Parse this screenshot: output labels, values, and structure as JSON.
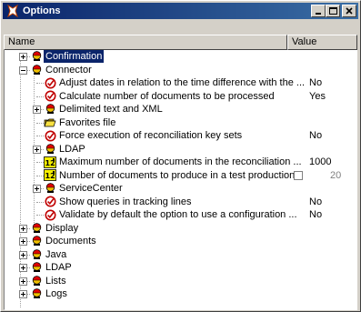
{
  "window": {
    "title": "Options"
  },
  "columns": {
    "name": "Name",
    "value": "Value"
  },
  "tree": [
    {
      "label": "Confirmation",
      "level": 0,
      "expander": "+",
      "icon": "folder-red-icon",
      "selected": true
    },
    {
      "label": "Connector",
      "level": 0,
      "expander": "-",
      "icon": "folder-icon"
    },
    {
      "label": "Adjust dates in relation to the time difference with the ...",
      "level": 1,
      "icon": "check-option-icon",
      "value": "No"
    },
    {
      "label": "Calculate number of documents to be processed",
      "level": 1,
      "icon": "check-option-icon",
      "value": "Yes"
    },
    {
      "label": "Delimited text and XML",
      "level": 1,
      "expander": "+",
      "icon": "folder-icon"
    },
    {
      "label": "Favorites file",
      "level": 1,
      "icon": "open-folder-icon"
    },
    {
      "label": "Force execution of reconciliation key sets",
      "level": 1,
      "icon": "check-option-icon",
      "value": "No"
    },
    {
      "label": "LDAP",
      "level": 1,
      "expander": "+",
      "icon": "folder-icon"
    },
    {
      "label": "Maximum number of documents in the reconciliation ...",
      "level": 1,
      "icon": "number-option-icon",
      "value": "1000"
    },
    {
      "label": "Number of documents to produce in a test production...",
      "level": 1,
      "icon": "number-option-icon",
      "value": "20",
      "checkbox": true,
      "gray": true
    },
    {
      "label": "ServiceCenter",
      "level": 1,
      "expander": "+",
      "icon": "folder-icon"
    },
    {
      "label": "Show queries in tracking lines",
      "level": 1,
      "icon": "check-option-icon",
      "value": "No"
    },
    {
      "label": "Validate by default the option to use a configuration ...",
      "level": 1,
      "icon": "check-option-icon",
      "value": "No"
    },
    {
      "label": "Display",
      "level": 0,
      "expander": "+",
      "icon": "folder-icon"
    },
    {
      "label": "Documents",
      "level": 0,
      "expander": "+",
      "icon": "folder-icon"
    },
    {
      "label": "Java",
      "level": 0,
      "expander": "+",
      "icon": "folder-icon"
    },
    {
      "label": "LDAP",
      "level": 0,
      "expander": "+",
      "icon": "folder-icon"
    },
    {
      "label": "Lists",
      "level": 0,
      "expander": "+",
      "icon": "folder-icon"
    },
    {
      "label": "Logs",
      "level": 0,
      "expander": "+",
      "icon": "folder-icon"
    }
  ]
}
